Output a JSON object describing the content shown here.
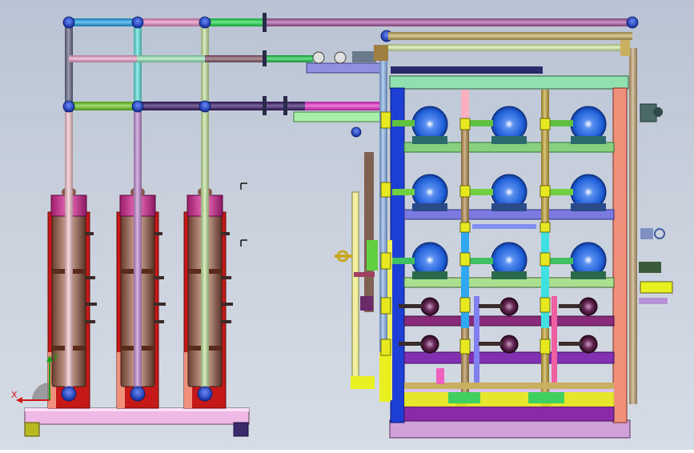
{
  "view": {
    "background_top": "#b9c3d3",
    "background_bottom": "#d6dce5"
  },
  "triad": {
    "x_label": "X",
    "y_label": "Y",
    "x_color": "#d01818",
    "y_color": "#18a018"
  },
  "colors": {
    "vessel_band": "#d2409a",
    "vessel_body": "#9a6a52",
    "frame_red": "#c51818",
    "skid_base": "#f0b8e4",
    "pump_blue": "#1f5fd8",
    "rack_post": "#1e3fd6",
    "rack_side": "#f0907a",
    "tray_green": "#88d080",
    "tray_purple": "#8030b0",
    "tray_violet": "#5a4ab0",
    "valve_yellow": "#e8e820",
    "manifold_top": "#7a4070"
  },
  "equipment": {
    "vessel_count": 3,
    "pump_rows": 3,
    "pumps_per_row": 3,
    "small_pump_rows": 2
  }
}
